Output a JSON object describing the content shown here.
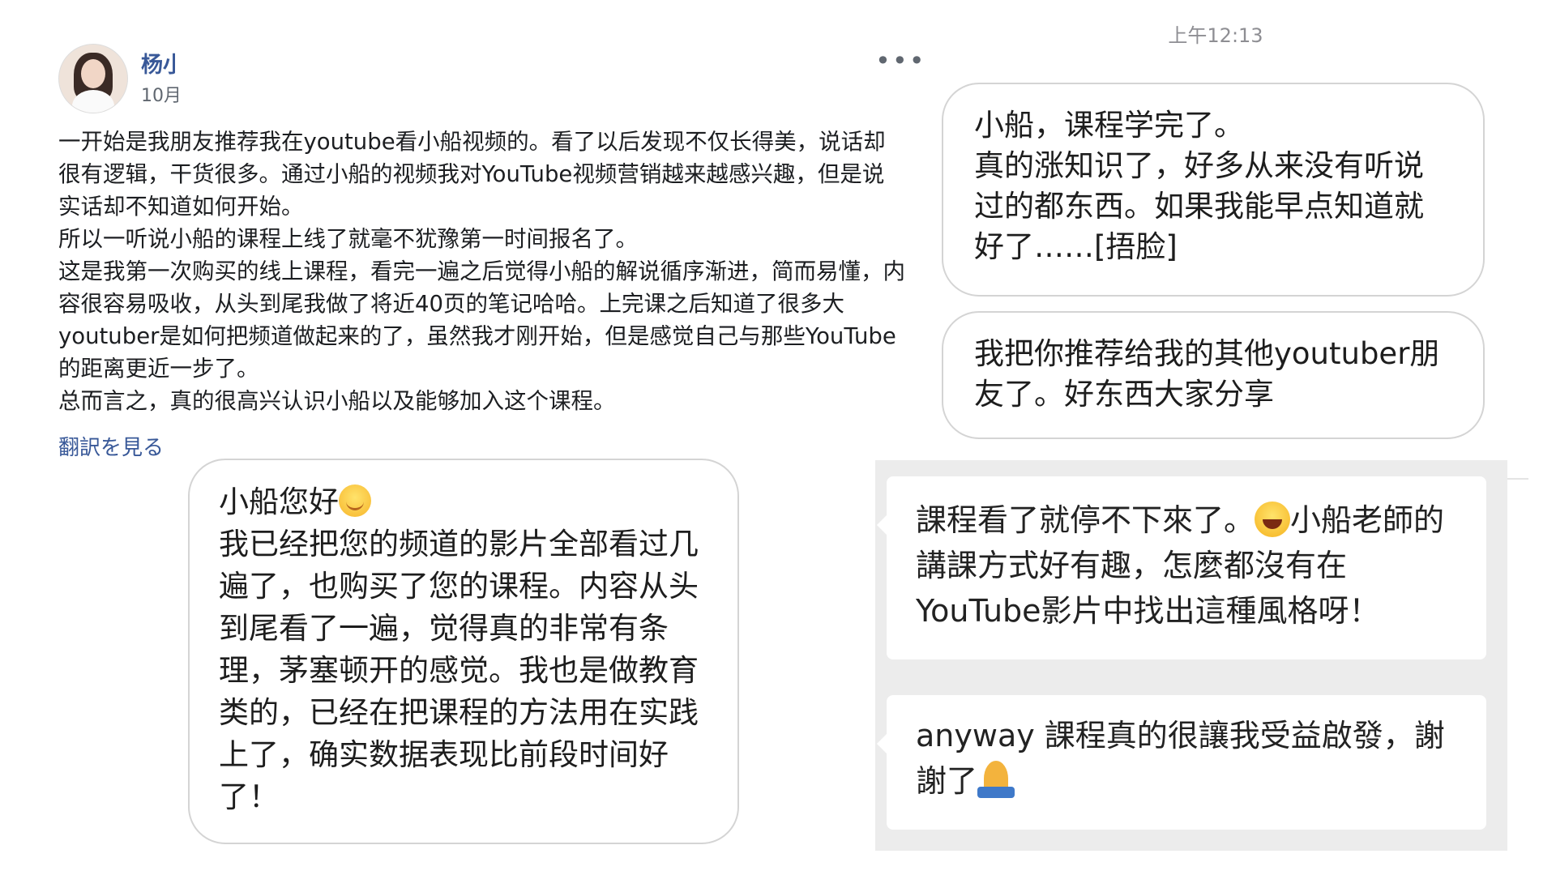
{
  "post": {
    "author": "杨小",
    "date": "10月",
    "paragraphs": [
      "一开始是我朋友推荐我在youtube看小船视频的。看了以后发现不仅长得美，说话却很有逻辑，干货很多。通过小船的视频我对YouTube视频营销越来越感兴趣，但是说实话却不知道如何开始。",
      "所以一听说小船的课程上线了就毫不犹豫第一时间报名了。",
      "这是我第一次购买的线上课程，看完一遍之后觉得小船的解说循序渐进，简而易懂，内容很容易吸收，从头到尾我做了将近40页的笔记哈哈。上完课之后知道了很多大youtuber是如何把频道做起来的了，虽然我才刚开始，但是感觉自己与那些YouTube的距离更近一步了。",
      "总而言之，真的很高兴认识小船以及能够加入这个课程。"
    ],
    "see_translation": "翻訳を見る",
    "more_label": "•••"
  },
  "chat_left": {
    "greeting": "小船您好",
    "message": "我已经把您的频道的影片全部看过几遍了，也购买了您的课程。内容从头到尾看了一遍，觉得真的非常有条理，茅塞顿开的感觉。我也是做教育类的，已经在把课程的方法用在实践上了，确实数据表现比前段时间好了！"
  },
  "chat_right": {
    "timestamp": "上午12:13",
    "messages": [
      "小船，课程学完了。\n真的涨知识了，好多从来没有听说过的都东西。如果我能早点知道就好了……[捂脸]",
      "我把你推荐给我的其他youtuber朋友了。好东西大家分享"
    ]
  },
  "chat_grey": {
    "card1_before": "課程看了就停不下來了。",
    "card1_after": "小船老師的講課方式好有趣，怎麼都沒有在YouTube影片中找出這種風格呀！",
    "card2_text": "anyway 課程真的很讓我受益啟發，謝謝了"
  },
  "colors": {
    "link": "#385898",
    "panel_bg": "#ececec",
    "bubble_border": "#d4d4d4"
  }
}
